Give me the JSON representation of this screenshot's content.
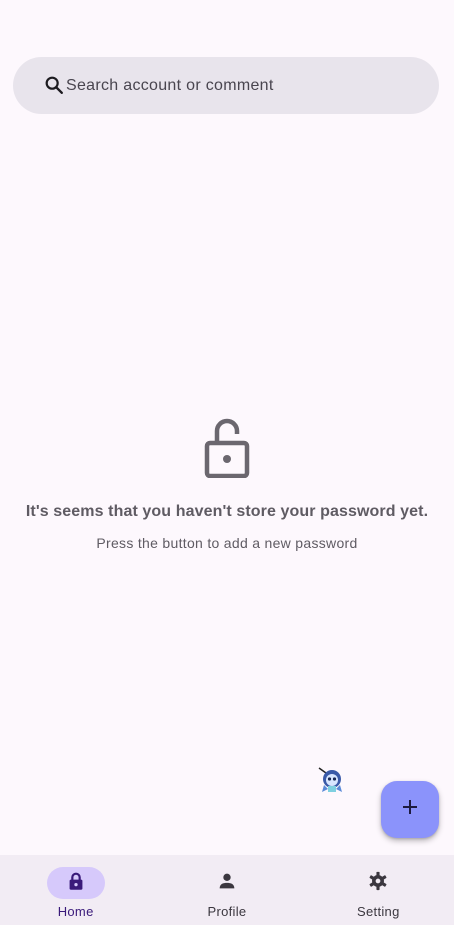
{
  "search": {
    "placeholder": "Search account or comment",
    "icon": "search-icon"
  },
  "empty_state": {
    "icon": "lock-open-icon",
    "title": "It's seems that you haven't store your password yet.",
    "subtitle": "Press the button to add a new password"
  },
  "fab": {
    "icon": "plus-icon",
    "color": "#8b93fb"
  },
  "bottom_nav": {
    "items": [
      {
        "label": "Home",
        "icon": "lock-icon",
        "active": true
      },
      {
        "label": "Profile",
        "icon": "person-icon",
        "active": false
      },
      {
        "label": "Setting",
        "icon": "gear-icon",
        "active": false
      }
    ],
    "active_color": "#d6c9fb"
  },
  "colors": {
    "background": "#fdf8fd",
    "search_bar": "#e8e4ec",
    "nav_background": "#f2ecf4"
  }
}
